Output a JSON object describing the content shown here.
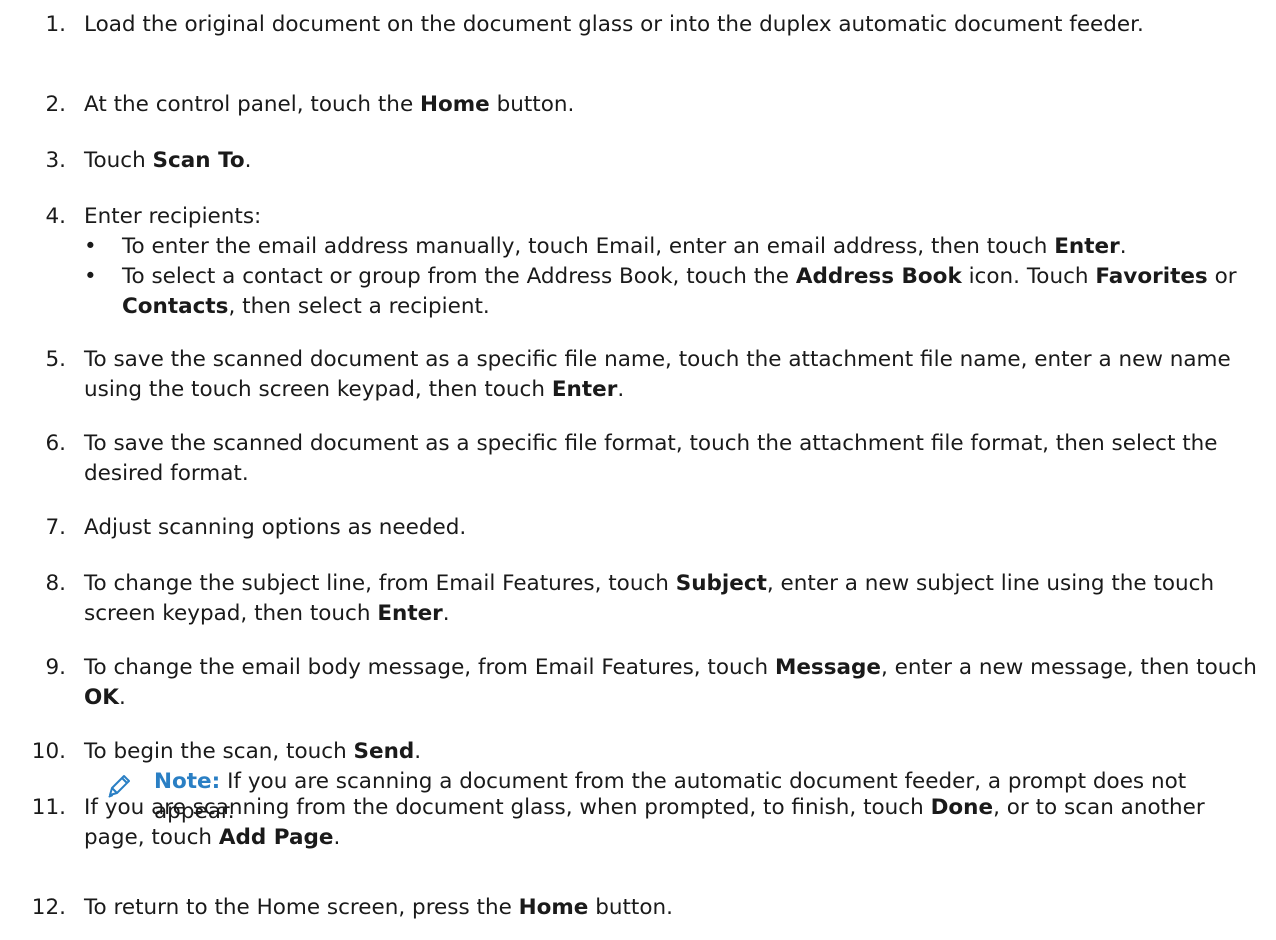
{
  "steps": [
    {
      "num": "1.",
      "parts": [
        "Load the original document on the document glass or into the duplex automatic document feeder."
      ]
    },
    {
      "num": "2.",
      "parts": [
        "At the control panel, touch the ",
        "Home",
        " button."
      ]
    },
    {
      "num": "3.",
      "parts": [
        "Touch ",
        "Scan To",
        "."
      ]
    },
    {
      "num": "4.",
      "parts": [
        "Enter recipients:"
      ],
      "bullets": [
        [
          "To enter the email address manually, touch Email, enter an email address, then touch ",
          "Enter",
          "."
        ],
        [
          "To select a contact or group from the Address Book, touch the ",
          "Address Book",
          " icon. Touch ",
          "Favorites",
          " or ",
          "Contacts",
          ", then select a recipient."
        ]
      ]
    },
    {
      "num": "5.",
      "parts": [
        "To save the scanned document as a specific file name, touch the attachment file name, enter a new name using the touch screen keypad, then touch ",
        "Enter",
        "."
      ]
    },
    {
      "num": "6.",
      "parts": [
        "To save the scanned document as a specific file format, touch the attachment file format, then select the desired format."
      ]
    },
    {
      "num": "7.",
      "parts": [
        "Adjust scanning options as needed."
      ]
    },
    {
      "num": "8.",
      "parts": [
        "To change the subject line, from Email Features, touch ",
        "Subject",
        ", enter a new subject line using the touch screen keypad, then touch ",
        "Enter",
        "."
      ]
    },
    {
      "num": "9.",
      "parts": [
        "To change the email body message, from Email Features, touch ",
        "Message",
        ", enter a new message, then touch ",
        "OK",
        "."
      ]
    },
    {
      "num": "10.",
      "parts": [
        "To begin the scan, touch ",
        "Send",
        "."
      ]
    },
    {
      "num": "11.",
      "parts": [
        "If you are scanning from the document glass, when prompted, to finish, touch ",
        "Done",
        ", or to scan another page, touch ",
        "Add Page",
        "."
      ]
    },
    {
      "num": "12.",
      "parts": [
        "To return to the Home screen, press the ",
        "Home",
        " button."
      ]
    }
  ],
  "note": {
    "label": "Note:",
    "text": " If you are scanning a document from the automatic document feeder, a prompt does not appear.",
    "icon": "pencil-icon"
  },
  "colors": {
    "note_accent": "#2a7fc4",
    "text": "#1a1a1a"
  }
}
